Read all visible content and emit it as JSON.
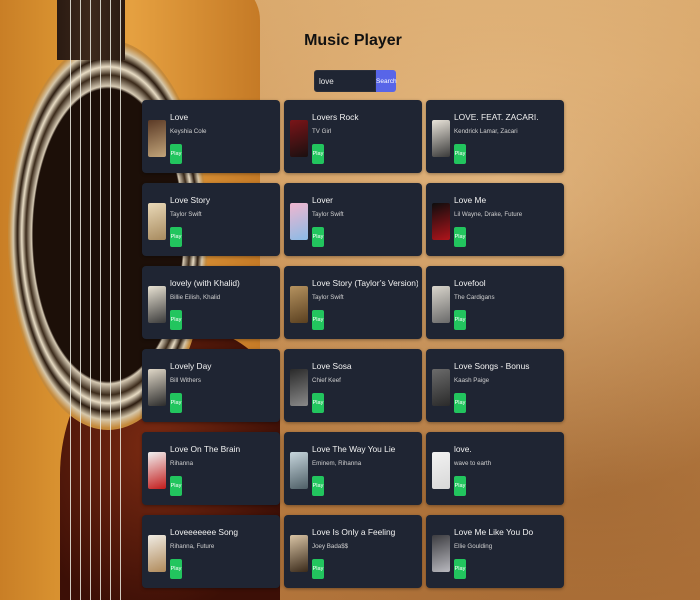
{
  "app": {
    "title": "Music Player"
  },
  "search": {
    "value": "love",
    "button_label": "Search"
  },
  "results": [
    {
      "song": "Love",
      "artist": "Keyshia Cole",
      "play": "Play",
      "art_colors": [
        "#5b3a26",
        "#c2a57a"
      ]
    },
    {
      "song": "Lovers Rock",
      "artist": "TV Girl",
      "play": "Play",
      "art_colors": [
        "#7a1418",
        "#1a1010"
      ]
    },
    {
      "song": "LOVE. FEAT. ZACARI.",
      "artist": "Kendrick Lamar, Zacari",
      "play": "Play",
      "art_colors": [
        "#e9e4da",
        "#3a3a3a"
      ]
    },
    {
      "song": "Love Story",
      "artist": "Taylor Swift",
      "play": "Play",
      "art_colors": [
        "#e9d9b8",
        "#a78a5e"
      ]
    },
    {
      "song": "Lover",
      "artist": "Taylor Swift",
      "play": "Play",
      "art_colors": [
        "#f0b6cf",
        "#8bbbe6"
      ]
    },
    {
      "song": "Love Me",
      "artist": "Lil Wayne, Drake, Future",
      "play": "Play",
      "art_colors": [
        "#0d0d0d",
        "#b0141b"
      ]
    },
    {
      "song": "lovely (with Khalid)",
      "artist": "Billie Eilish, Khalid",
      "play": "Play",
      "art_colors": [
        "#e8e2d3",
        "#3b3b3b"
      ]
    },
    {
      "song": "Love Story (Taylor’s Version)",
      "artist": "Taylor Swift",
      "play": "Play",
      "art_colors": [
        "#b5925f",
        "#5a4020"
      ]
    },
    {
      "song": "Lovefool",
      "artist": "The Cardigans",
      "play": "Play",
      "art_colors": [
        "#d9d5cc",
        "#6a6a6a"
      ]
    },
    {
      "song": "Lovely Day",
      "artist": "Bill Withers",
      "play": "Play",
      "art_colors": [
        "#e0d8c8",
        "#2b2b2b"
      ]
    },
    {
      "song": "Love Sosa",
      "artist": "Chief Keef",
      "play": "Play",
      "art_colors": [
        "#2a2a2a",
        "#8a8a8a"
      ]
    },
    {
      "song": "Love Songs - Bonus",
      "artist": "Kaash Paige",
      "play": "Play",
      "art_colors": [
        "#6b6b6b",
        "#2a2a2a"
      ]
    },
    {
      "song": "Love On The Brain",
      "artist": "Rihanna",
      "play": "Play",
      "art_colors": [
        "#f1f1f1",
        "#c21a1a"
      ]
    },
    {
      "song": "Love The Way You Lie",
      "artist": "Eminem, Rihanna",
      "play": "Play",
      "art_colors": [
        "#c7d6dd",
        "#4d5e66"
      ]
    },
    {
      "song": "love.",
      "artist": "wave to earth",
      "play": "Play",
      "art_colors": [
        "#f2f2f2",
        "#d8d8d8"
      ]
    },
    {
      "song": "Loveeeeeee Song",
      "artist": "Rihanna, Future",
      "play": "Play",
      "art_colors": [
        "#f0ece4",
        "#b08a5a"
      ]
    },
    {
      "song": "Love Is Only a Feeling",
      "artist": "Joey Bada$$",
      "play": "Play",
      "art_colors": [
        "#d9c4a5",
        "#3a2a1a"
      ]
    },
    {
      "song": "Love Me Like You Do",
      "artist": "Ellie Goulding",
      "play": "Play",
      "art_colors": [
        "#3c3c40",
        "#b9b9bf"
      ]
    }
  ]
}
